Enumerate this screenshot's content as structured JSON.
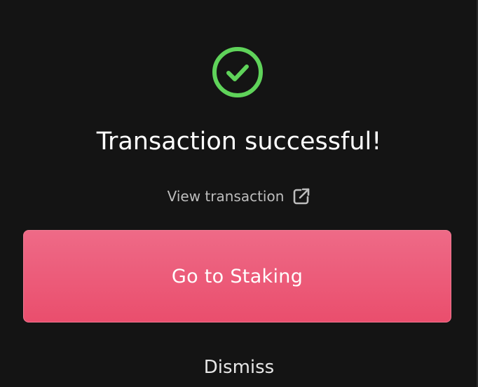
{
  "dialog": {
    "status_icon": "check-circle-icon",
    "title": "Transaction successful!",
    "view_transaction_label": "View transaction",
    "view_transaction_icon": "external-link-icon",
    "primary_button_label": "Go to Staking",
    "dismiss_label": "Dismiss"
  },
  "colors": {
    "background": "#141414",
    "success": "#5fd35a",
    "accent": "#ea4e6d",
    "text_primary": "#ffffff",
    "text_secondary": "#bdbdbd"
  }
}
